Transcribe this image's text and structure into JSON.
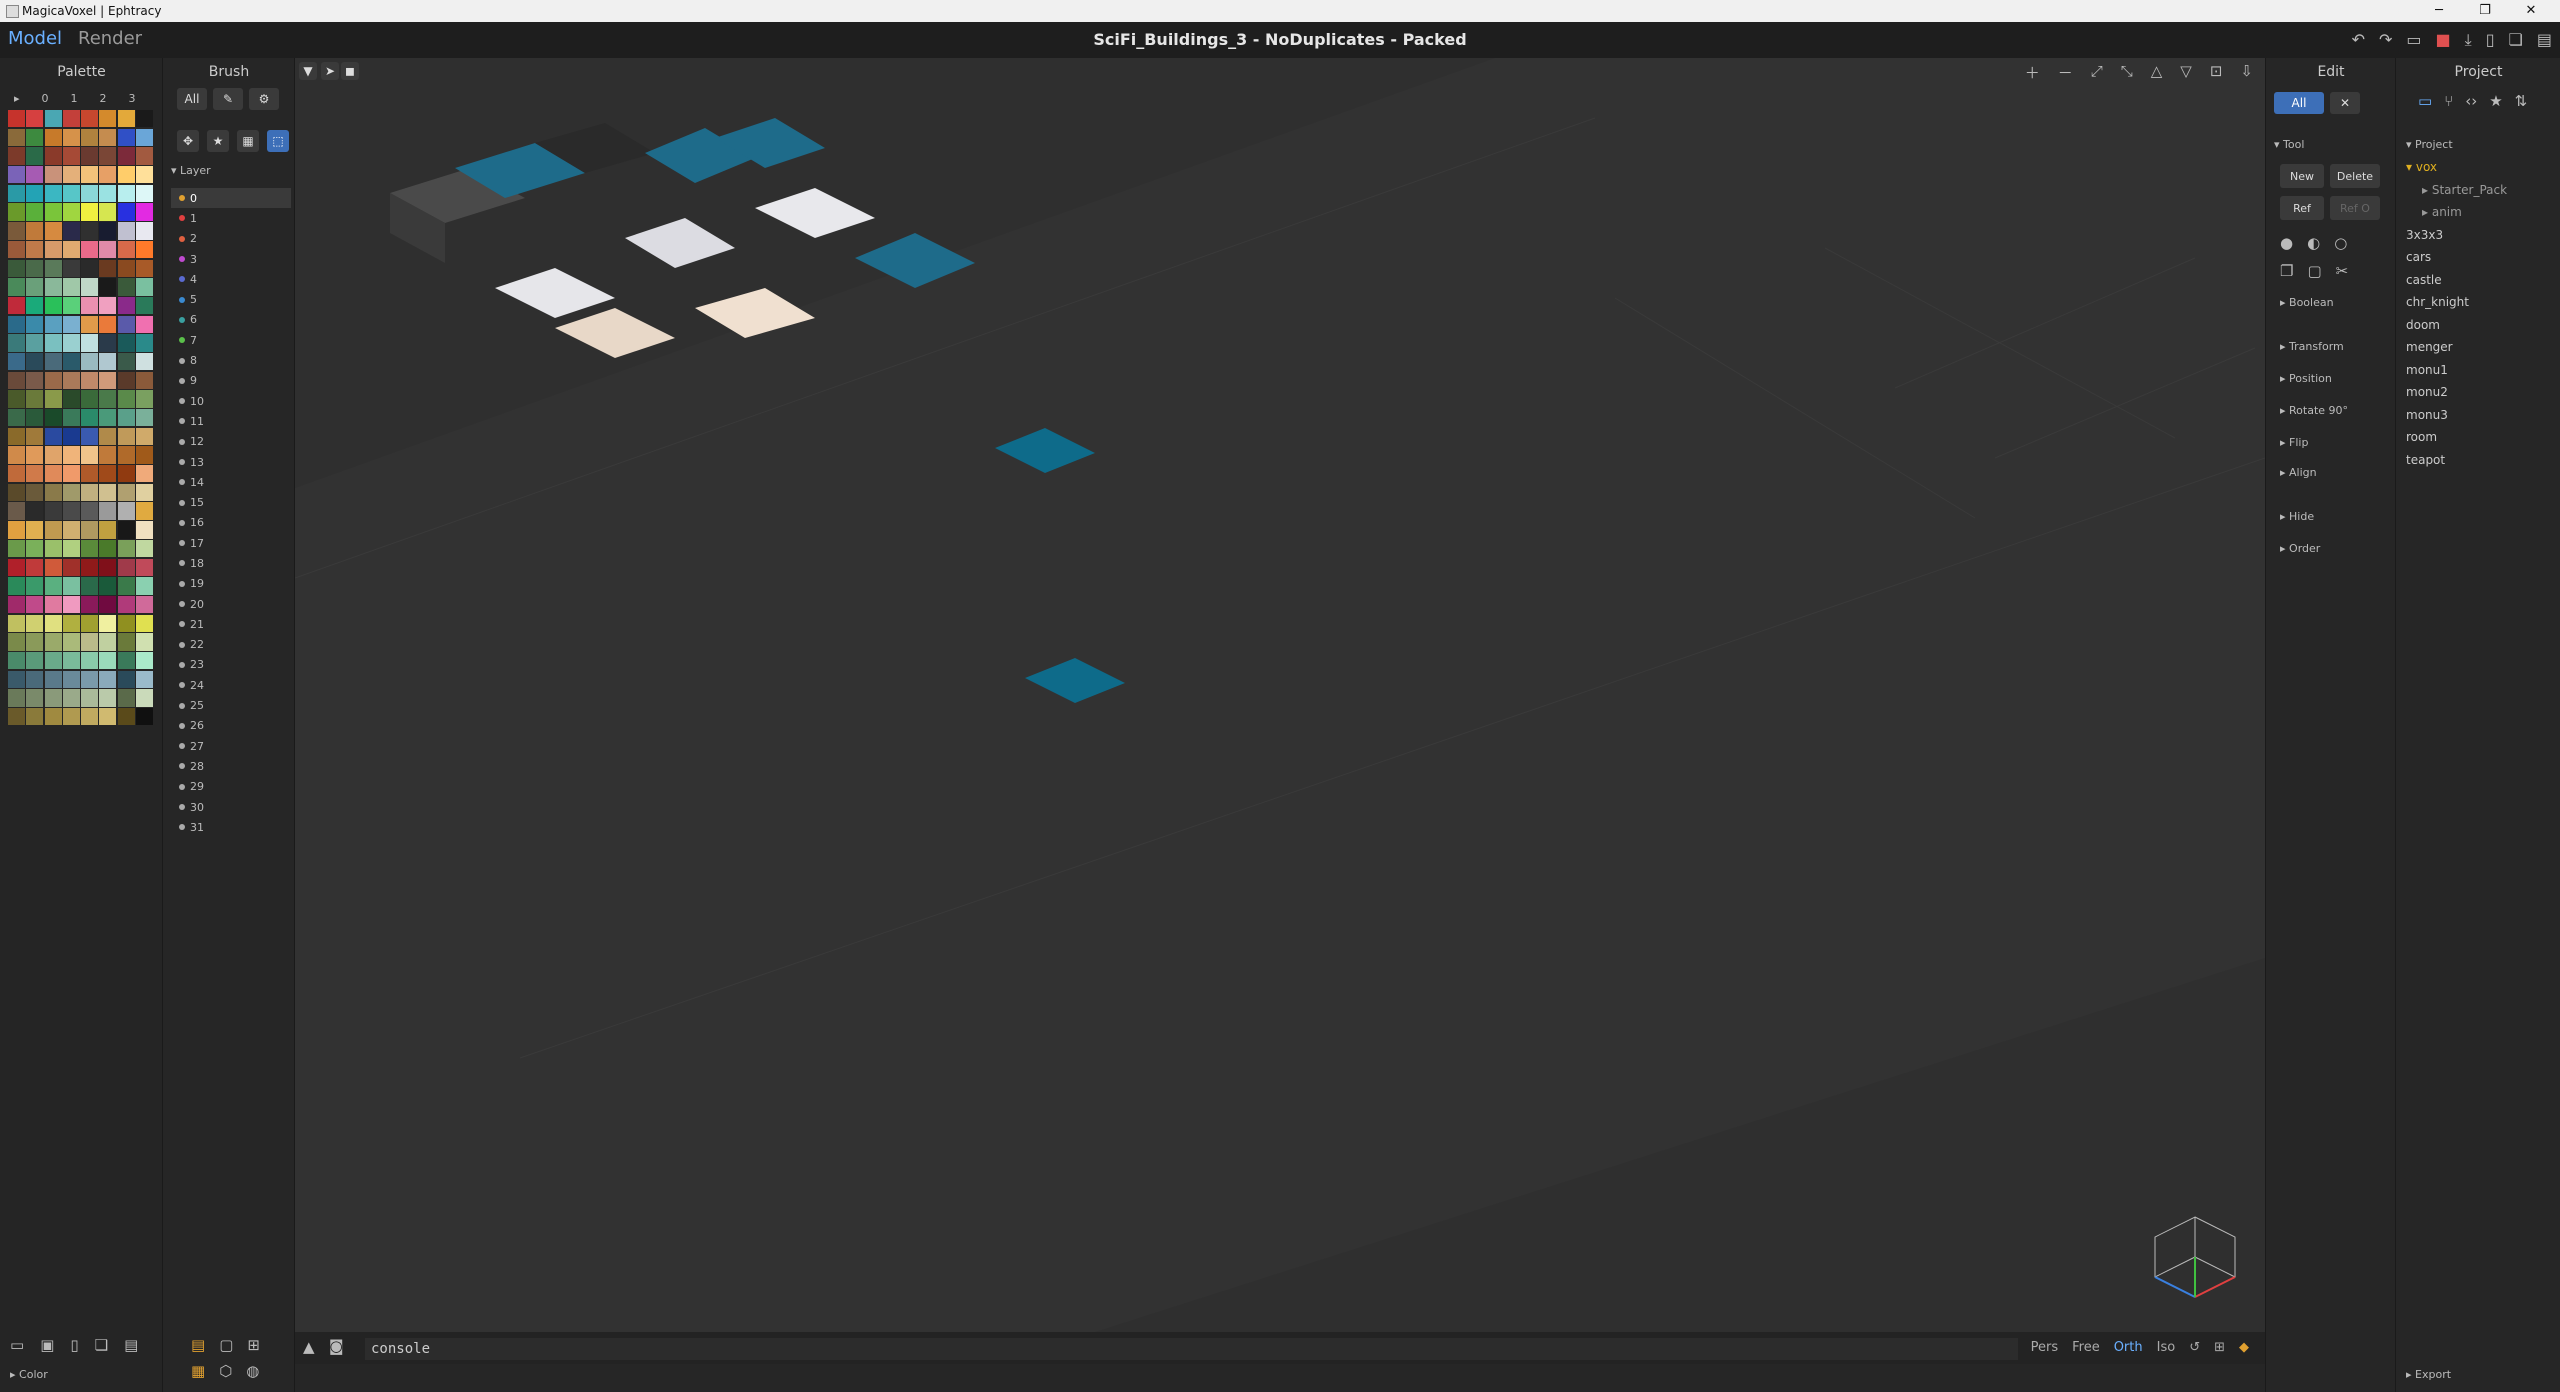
{
  "window": {
    "title": "MagicaVoxel | Ephtracy",
    "buttons": [
      "─",
      "❐",
      "✕"
    ]
  },
  "menu": {
    "modes": [
      "Model",
      "Render"
    ],
    "active_mode": "Model",
    "document_title": "SciFi_Buildings_3 - NoDuplicates - Packed",
    "actions": [
      "undo-icon",
      "redo-icon",
      "open-icon",
      "save-icon",
      "export-icon",
      "new-icon",
      "copy-icon",
      "delete-icon"
    ]
  },
  "palette": {
    "header": "Palette",
    "page_labels": [
      "▸",
      "0",
      "1",
      "2",
      "3"
    ],
    "footer_label": "Color",
    "colors": [
      "#c6332c",
      "#d64040",
      "#4aa7b3",
      "#c3403a",
      "#c7472e",
      "#d48a2c",
      "#e3a93a",
      "#1a1a1a",
      "#8a6a3a",
      "#3d8a3f",
      "#c77a2a",
      "#d6924a",
      "#b0823e",
      "#c58c4f",
      "#3050c6",
      "#6aa6d8",
      "#7c3a2a",
      "#2a6a48",
      "#8a3a2a",
      "#a64a36",
      "#6a3a30",
      "#7a4636",
      "#7c2a3a",
      "#a25a40",
      "#7a63b8",
      "#a65bb3",
      "#c9927a",
      "#e4b07a",
      "#f2c27a",
      "#e7a066",
      "#ffcd6a",
      "#ffe09a",
      "#2a9aa6",
      "#23a3b5",
      "#3bb7c2",
      "#57c6c8",
      "#8ad7d8",
      "#9ae2e2",
      "#b8eeee",
      "#ddf7f7",
      "#6a9a2a",
      "#5ab03a",
      "#7ac53a",
      "#a0d640",
      "#f0f040",
      "#d6e650",
      "#2830e0",
      "#e22ae2",
      "#7a5a3a",
      "#c07a3a",
      "#d68a40",
      "#2a2a4a",
      "#303030",
      "#181c30",
      "#c0c0d0",
      "#e8e8f0",
      "#9a5a3a",
      "#c07a4a",
      "#d79a6a",
      "#e0aa70",
      "#ea6a8a",
      "#e08aa8",
      "#d86a4a",
      "#ff7a2a",
      "#3a5a3a",
      "#4a6a4a",
      "#5a7a5a",
      "#3a3a3a",
      "#2a2a2a",
      "#6a3a20",
      "#8a4a20",
      "#a85a28",
      "#4a8a5a",
      "#6aa07a",
      "#8ab89a",
      "#a0c8a8",
      "#c0d8c8",
      "#1a1a1a",
      "#3a5a3a",
      "#7ac0a0",
      "#c02a3a",
      "#1aaa7a",
      "#2ac05a",
      "#5ad07a",
      "#ea90b0",
      "#f0a0c0",
      "#8a2a8a",
      "#2a7a5a",
      "#2a6a8a",
      "#3a8aaa",
      "#5aa0c0",
      "#7ab0d0",
      "#e09a4a",
      "#ea7a3a",
      "#5a5aaa",
      "#f070b0",
      "#3a7a7a",
      "#5aa0a0",
      "#7ac0c0",
      "#9ad0d0",
      "#c0e0e0",
      "#2a3a4a",
      "#1a5a5a",
      "#2a8a8a",
      "#3a6a8a",
      "#2a4a5a",
      "#4a6a7a",
      "#2a5a6a",
      "#9abac0",
      "#b0c8d0",
      "#3a5a4a",
      "#cfe0e0",
      "#6a4a3a",
      "#7a5a4a",
      "#9a6a4a",
      "#aa7a5a",
      "#c08a6a",
      "#d09a7a",
      "#5a3a2a",
      "#8a5a3a",
      "#4a5a2a",
      "#6a7a3a",
      "#8a9a4a",
      "#2a4a2a",
      "#3a6a3a",
      "#4a7a4a",
      "#5a8a4a",
      "#7aa060",
      "#3a6a4a",
      "#2a5a3a",
      "#1a4a2a",
      "#3a7a5a",
      "#2a8a6a",
      "#4a9a7a",
      "#5aa08a",
      "#7ab09a",
      "#8a6a2a",
      "#a07a3a",
      "#2a4aa0",
      "#1a3a90",
      "#3a5ab0",
      "#b08a4a",
      "#c09a5a",
      "#d0aa6a",
      "#d08a4a",
      "#e09a5a",
      "#e0a46a",
      "#f0b47a",
      "#f0c48a",
      "#c07a3a",
      "#b06a2a",
      "#a05a1a",
      "#c06a3a",
      "#d07a4a",
      "#e08a5a",
      "#f09a6a",
      "#b05a2a",
      "#a04a1a",
      "#903a10",
      "#f0aa7a",
      "#5a4a2a",
      "#6a5a3a",
      "#8a7a4a",
      "#a09a6a",
      "#c0b080",
      "#d0c090",
      "#b0a070",
      "#e0d0a0",
      "#6a5a4a",
      "#2a2a2a",
      "#3a3a3a",
      "#4a4a4a",
      "#5a5a5a",
      "#9a9a9a",
      "#b0b0b0",
      "#e0aa40",
      "#e0a040",
      "#e0b050",
      "#c09a50",
      "#d0b070",
      "#b09a60",
      "#c0a040",
      "#181818",
      "#f0e0c0",
      "#6a9a4a",
      "#7ab05a",
      "#9ac06a",
      "#b0d080",
      "#5a8a3a",
      "#4a7a2a",
      "#7aa05a",
      "#c0d8a0",
      "#b0202a",
      "#c03a3a",
      "#d05a3a",
      "#a0302a",
      "#901a1a",
      "#80101a",
      "#a03a4a",
      "#c04a5a",
      "#2a8a5a",
      "#3a9a6a",
      "#5ab080",
      "#7ac0a0",
      "#2a6a4a",
      "#1a5a3a",
      "#3a7a4a",
      "#8ad0b0",
      "#a02a6a",
      "#c04a8a",
      "#e07aa0",
      "#f09ac0",
      "#8a1a5a",
      "#700a40",
      "#b03a7a",
      "#d06a9a",
      "#c0c060",
      "#d0d070",
      "#e0e080",
      "#b0b040",
      "#a0a030",
      "#f0f0a0",
      "#909020",
      "#e0e050",
      "#7a8a4a",
      "#8a9a5a",
      "#9aaa6a",
      "#aaba7a",
      "#babb8a",
      "#c0d0a0",
      "#6a7a3a",
      "#d0e0b0",
      "#4a8a6a",
      "#5a9a7a",
      "#6aaa8a",
      "#7aba9a",
      "#8acaaa",
      "#9adaba",
      "#3a7a5a",
      "#aaeaca",
      "#3a5a6a",
      "#4a6a7a",
      "#5a7a8a",
      "#6a8a9a",
      "#7a9aaa",
      "#8aaaba",
      "#2a4a5a",
      "#9abaca",
      "#6a7a5a",
      "#7a8a6a",
      "#8a9a7a",
      "#9aaa8a",
      "#aaba9a",
      "#bacaaa",
      "#5a6a4a",
      "#cadaba",
      "#6a5a2a",
      "#8a7a3a",
      "#a08a40",
      "#b09a50",
      "#c0aa60",
      "#d0ba70",
      "#5a4a1a",
      "#101010"
    ]
  },
  "brush": {
    "header": "Brush",
    "filter_all": "All",
    "layer_header": "Layer",
    "layers": [
      {
        "label": "0",
        "color": "#e0a030"
      },
      {
        "label": "1",
        "color": "#e04040"
      },
      {
        "label": "2",
        "color": "#e06040"
      },
      {
        "label": "3",
        "color": "#c04ad0"
      },
      {
        "label": "4",
        "color": "#5a6ad0"
      },
      {
        "label": "5",
        "color": "#3a8ad0"
      },
      {
        "label": "6",
        "color": "#3aa0a0"
      },
      {
        "label": "7",
        "color": "#5ac04a"
      },
      {
        "label": "8",
        "color": "#aaaaaa"
      },
      {
        "label": "9",
        "color": "#aaaaaa"
      },
      {
        "label": "10",
        "color": "#aaaaaa"
      },
      {
        "label": "11",
        "color": "#aaaaaa"
      },
      {
        "label": "12",
        "color": "#aaaaaa"
      },
      {
        "label": "13",
        "color": "#aaaaaa"
      },
      {
        "label": "14",
        "color": "#aaaaaa"
      },
      {
        "label": "15",
        "color": "#aaaaaa"
      },
      {
        "label": "16",
        "color": "#aaaaaa"
      },
      {
        "label": "17",
        "color": "#aaaaaa"
      },
      {
        "label": "18",
        "color": "#aaaaaa"
      },
      {
        "label": "19",
        "color": "#aaaaaa"
      },
      {
        "label": "20",
        "color": "#aaaaaa"
      },
      {
        "label": "21",
        "color": "#aaaaaa"
      },
      {
        "label": "22",
        "color": "#aaaaaa"
      },
      {
        "label": "23",
        "color": "#aaaaaa"
      },
      {
        "label": "24",
        "color": "#aaaaaa"
      },
      {
        "label": "25",
        "color": "#aaaaaa"
      },
      {
        "label": "26",
        "color": "#aaaaaa"
      },
      {
        "label": "27",
        "color": "#aaaaaa"
      },
      {
        "label": "28",
        "color": "#aaaaaa"
      },
      {
        "label": "29",
        "color": "#aaaaaa"
      },
      {
        "label": "30",
        "color": "#aaaaaa"
      },
      {
        "label": "31",
        "color": "#aaaaaa"
      }
    ]
  },
  "edit": {
    "header": "Edit",
    "filter_all": "All",
    "tool_header": "Tool",
    "new_label": "New",
    "delete_label": "Delete",
    "ref_label": "Ref",
    "refo_label": "Ref O",
    "sections": [
      "Boolean",
      "Transform",
      "Position",
      "Rotate 90°",
      "Flip",
      "Align",
      "Hide",
      "Order"
    ]
  },
  "project": {
    "header": "Project",
    "section_label": "Project",
    "folder": "vox",
    "subfolders": [
      "Starter_Pack",
      "anim"
    ],
    "files": [
      "3x3x3",
      "cars",
      "castle",
      "chr_knight",
      "doom",
      "menger",
      "monu1",
      "monu2",
      "monu3",
      "room",
      "teapot"
    ],
    "export_label": "Export"
  },
  "console": {
    "value": "console",
    "view_modes": [
      "Pers",
      "Free",
      "Orth",
      "Iso"
    ],
    "active_view": "Orth"
  },
  "colors": {
    "accent": "#3d6fb8",
    "active_text": "#6ab0ff",
    "folder": "#e0b020"
  }
}
